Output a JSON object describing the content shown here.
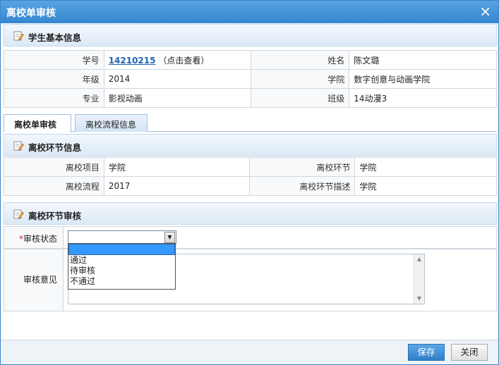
{
  "dialog": {
    "title": "离校单审核",
    "close_glyph": "×"
  },
  "student_section": {
    "title": "学生基本信息",
    "rows": [
      {
        "label_left": "学号",
        "value_left_link": "14210215",
        "value_left_hint": "（点击查看）",
        "label_right": "姓名",
        "value_right": "陈文璐"
      },
      {
        "label_left": "年级",
        "value_left": "2014",
        "label_right": "学院",
        "value_right": "数字创意与动画学院"
      },
      {
        "label_left": "专业",
        "value_left": "影视动画",
        "label_right": "班级",
        "value_right": "14动漫3"
      }
    ]
  },
  "tabs": [
    {
      "label": "离校单审核",
      "active": true
    },
    {
      "label": "离校流程信息",
      "active": false
    }
  ],
  "stage_section": {
    "title": "离校环节信息",
    "rows": [
      {
        "label_left": "离校项目",
        "value_left": "学院",
        "label_right": "离校环节",
        "value_right": "学院"
      },
      {
        "label_left": "离校流程",
        "value_left": "2017",
        "label_right": "离校环节描述",
        "value_right": "学院"
      }
    ]
  },
  "review_section": {
    "title": "离校环节审核",
    "status_label": "审核状态",
    "required_mark": "*",
    "status_value": "",
    "status_options": [
      "",
      "通过",
      "待审核",
      "不通过"
    ],
    "comment_label": "审核意见",
    "comment_value": ""
  },
  "footer": {
    "save_label": "保存",
    "close_label": "关闭"
  },
  "colors": {
    "titlebar": "#3486d0",
    "link": "#1c64b4",
    "primary_button": "#2f7fca"
  }
}
